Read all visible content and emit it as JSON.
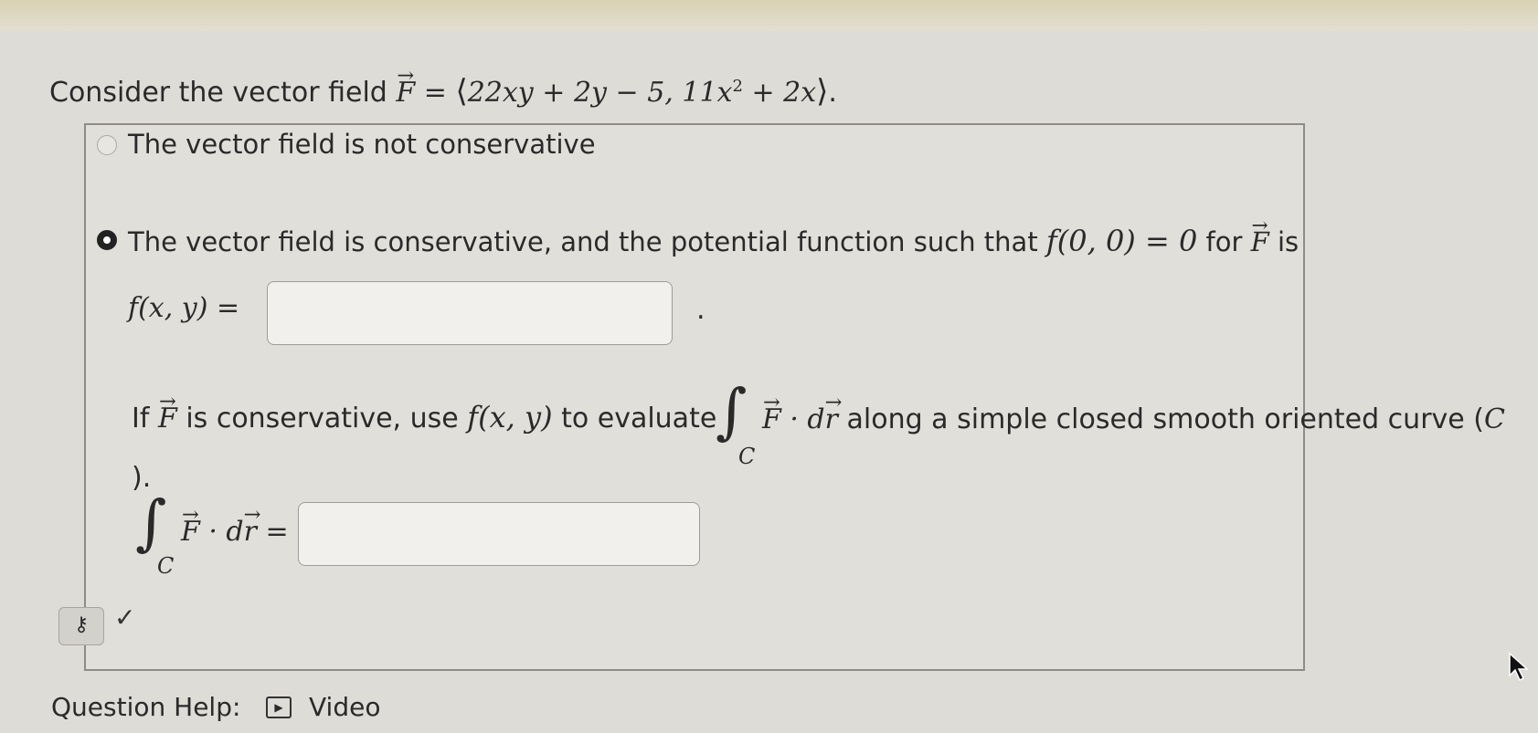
{
  "question": {
    "lead": "Consider the vector field",
    "field_name": "F",
    "equals": " = ",
    "open": "⟨",
    "comp1": "22xy + 2y − 5, ",
    "comp2_coef": "11x",
    "comp2_exp": "2",
    "comp2_tail": " + 2x",
    "close": "⟩",
    "end": "."
  },
  "options": [
    {
      "text": "The vector field is not conservative",
      "selected": false
    },
    {
      "text_pre": "The vector field is conservative, and the potential function such that ",
      "cond": "f(0, 0) = 0",
      "text_mid": " for ",
      "vec": "F",
      "text_post": " is",
      "selected": true
    }
  ],
  "potential": {
    "label": "f(x, y) =",
    "value": "",
    "trailing": "."
  },
  "evaluate": {
    "pre": "If ",
    "vec": "F",
    "mid": " is conservative, use ",
    "func": "f(x, y)",
    "post": " to evaluate",
    "integral_sign": "∫",
    "subscript": "C",
    "integrand_vec": "F",
    "dot": " · d",
    "r_vec": "r",
    "tail": " along a simple closed smooth oriented curve (",
    "tail_var": "C",
    "line2": ")."
  },
  "integral_answer": {
    "sign": "∫",
    "subscript": "C",
    "vec": "F",
    "dot": " · d",
    "r_vec": "r",
    "equals": " =",
    "value": ""
  },
  "key_glyph": "⚷",
  "check_glyph": "✓",
  "help": {
    "label": "Question Help:",
    "video_icon": "▶",
    "video": "Video"
  }
}
